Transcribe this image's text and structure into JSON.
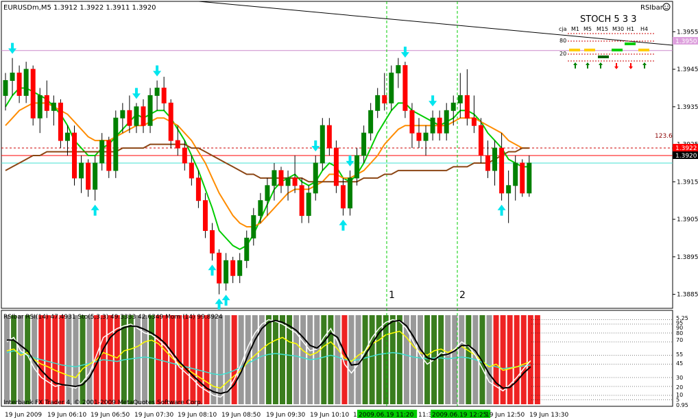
{
  "window": {
    "symbol_line": "EURUSDm,M5  1.3912 1.3922 1.3911 1.3920",
    "indicator_tag": "RSIbar",
    "corner_icon": "smiley-icon"
  },
  "stoch_panel": {
    "title": "STOCH  5 3 3",
    "row_label": "cja",
    "timeframes": [
      "M1",
      "M5",
      "M15",
      "M30",
      "H1",
      "H4"
    ],
    "level_hi": "80",
    "level_lo": "20",
    "directions": [
      "up",
      "up",
      "up",
      "down",
      "down",
      "up"
    ],
    "colors": {
      "up": "#008000",
      "down": "#ff0000",
      "bar_yellow": "#ffcc00",
      "bar_green": "#00cc00",
      "bar_dark": "#006400"
    }
  },
  "markers": {
    "vline_1": "1",
    "vline_2": "2",
    "fib_label": "123.6"
  },
  "price_axis": {
    "ticks": [
      "1.3955",
      "1.3945",
      "1.3935",
      "1.3925",
      "1.3915",
      "1.3905",
      "1.3895",
      "1.3885"
    ],
    "tag_pink": "1.3950",
    "tag_red": "1.3922",
    "tag_black": "1.3920"
  },
  "sub_window": {
    "header": "RSIbar RSI(14) 47.4931  Sto(5,3,3) 49.3333  42.6349  Mom (14) 99.8924",
    "footer": "Interbank FX Trader 4, © 2001-2009 MetaQuotes Software Corp.",
    "axis_ticks": [
      "5.25",
      "95",
      "90",
      "80",
      "70",
      "55",
      "45",
      "30",
      "20",
      "10",
      "5",
      "0.95"
    ]
  },
  "time_axis": {
    "labels": [
      "19 Jun 2009",
      "19 Jun 06:10",
      "19 Jun 06:50",
      "19 Jun 07:30",
      "19 Jun 08:10",
      "19 Jun 08:50",
      "19 Jun 09:30",
      "19 Jun 10:10",
      "19",
      "2009.06.19 11:20",
      "11:30",
      "2009.06.19 12:25",
      "19 Jun 12:50",
      "19 Jun 13:30"
    ]
  },
  "chart_data": {
    "type": "candlestick",
    "symbol": "EURUSDm",
    "timeframe": "M5",
    "ohlc_header": {
      "open": 1.3912,
      "high": 1.3922,
      "low": 1.3911,
      "close": 1.392
    },
    "ylim": [
      1.3882,
      1.3962
    ],
    "candles": [
      [
        1.3938,
        1.3944,
        1.3934,
        1.3942
      ],
      [
        1.3942,
        1.3948,
        1.3938,
        1.3944
      ],
      [
        1.3944,
        1.3946,
        1.3936,
        1.3938
      ],
      [
        1.3938,
        1.3947,
        1.3936,
        1.3945
      ],
      [
        1.3945,
        1.3946,
        1.393,
        1.3932
      ],
      [
        1.3932,
        1.394,
        1.3928,
        1.3938
      ],
      [
        1.3938,
        1.3942,
        1.3932,
        1.3934
      ],
      [
        1.3934,
        1.3938,
        1.393,
        1.3936
      ],
      [
        1.3936,
        1.3937,
        1.3924,
        1.3926
      ],
      [
        1.3926,
        1.393,
        1.3922,
        1.3928
      ],
      [
        1.3928,
        1.393,
        1.3914,
        1.3916
      ],
      [
        1.3916,
        1.3922,
        1.3912,
        1.392
      ],
      [
        1.392,
        1.3921,
        1.3911,
        1.3913
      ],
      [
        1.3913,
        1.3922,
        1.391,
        1.392
      ],
      [
        1.392,
        1.3928,
        1.3918,
        1.3926
      ],
      [
        1.3926,
        1.3927,
        1.3916,
        1.3918
      ],
      [
        1.3918,
        1.3934,
        1.3916,
        1.3932
      ],
      [
        1.3932,
        1.3936,
        1.3928,
        1.3934
      ],
      [
        1.3934,
        1.3938,
        1.3928,
        1.393
      ],
      [
        1.393,
        1.3936,
        1.3928,
        1.3935
      ],
      [
        1.3935,
        1.3937,
        1.3928,
        1.393
      ],
      [
        1.393,
        1.394,
        1.3928,
        1.3938
      ],
      [
        1.3938,
        1.3942,
        1.3934,
        1.394
      ],
      [
        1.394,
        1.3943,
        1.3934,
        1.3936
      ],
      [
        1.3936,
        1.3937,
        1.3924,
        1.3926
      ],
      [
        1.3926,
        1.393,
        1.3922,
        1.3924
      ],
      [
        1.3924,
        1.3926,
        1.3918,
        1.392
      ],
      [
        1.392,
        1.3922,
        1.3914,
        1.3916
      ],
      [
        1.3916,
        1.3918,
        1.3908,
        1.391
      ],
      [
        1.391,
        1.3912,
        1.39,
        1.3902
      ],
      [
        1.3902,
        1.3904,
        1.3894,
        1.3896
      ],
      [
        1.3896,
        1.3897,
        1.3885,
        1.3888
      ],
      [
        1.3888,
        1.3896,
        1.3886,
        1.3894
      ],
      [
        1.3894,
        1.3895,
        1.3888,
        1.389
      ],
      [
        1.389,
        1.3896,
        1.3888,
        1.3894
      ],
      [
        1.3894,
        1.3902,
        1.3892,
        1.39
      ],
      [
        1.39,
        1.3908,
        1.3898,
        1.3906
      ],
      [
        1.3906,
        1.3912,
        1.3904,
        1.391
      ],
      [
        1.391,
        1.3916,
        1.3906,
        1.3914
      ],
      [
        1.3914,
        1.392,
        1.391,
        1.3918
      ],
      [
        1.3918,
        1.3919,
        1.3912,
        1.3914
      ],
      [
        1.3914,
        1.3918,
        1.391,
        1.3916
      ],
      [
        1.3916,
        1.3922,
        1.3912,
        1.3914
      ],
      [
        1.3914,
        1.3916,
        1.3904,
        1.3906
      ],
      [
        1.3906,
        1.3914,
        1.3904,
        1.3912
      ],
      [
        1.3912,
        1.3922,
        1.391,
        1.392
      ],
      [
        1.392,
        1.3932,
        1.3918,
        1.393
      ],
      [
        1.393,
        1.3932,
        1.3922,
        1.3924
      ],
      [
        1.3924,
        1.3926,
        1.3912,
        1.3914
      ],
      [
        1.3914,
        1.3916,
        1.3906,
        1.3908
      ],
      [
        1.3908,
        1.3918,
        1.3906,
        1.3916
      ],
      [
        1.3916,
        1.3924,
        1.3914,
        1.3922
      ],
      [
        1.3922,
        1.393,
        1.392,
        1.3928
      ],
      [
        1.3928,
        1.3936,
        1.3926,
        1.3934
      ],
      [
        1.3934,
        1.394,
        1.3932,
        1.3938
      ],
      [
        1.3938,
        1.3944,
        1.3934,
        1.3936
      ],
      [
        1.3936,
        1.3946,
        1.3934,
        1.3944
      ],
      [
        1.3944,
        1.3948,
        1.394,
        1.3946
      ],
      [
        1.3946,
        1.3947,
        1.3932,
        1.3934
      ],
      [
        1.3934,
        1.3936,
        1.3924,
        1.3928
      ],
      [
        1.3928,
        1.3932,
        1.3924,
        1.3926
      ],
      [
        1.3926,
        1.393,
        1.3922,
        1.3928
      ],
      [
        1.3928,
        1.3934,
        1.3926,
        1.3932
      ],
      [
        1.3932,
        1.3934,
        1.3926,
        1.3928
      ],
      [
        1.3928,
        1.3936,
        1.3926,
        1.3934
      ],
      [
        1.3934,
        1.3938,
        1.393,
        1.3936
      ],
      [
        1.3936,
        1.3944,
        1.3932,
        1.3938
      ],
      [
        1.3938,
        1.3945,
        1.393,
        1.3932
      ],
      [
        1.3932,
        1.3938,
        1.3928,
        1.393
      ],
      [
        1.393,
        1.3932,
        1.392,
        1.3922
      ],
      [
        1.3922,
        1.3926,
        1.3916,
        1.3918
      ],
      [
        1.3918,
        1.3926,
        1.3914,
        1.3924
      ],
      [
        1.3924,
        1.3928,
        1.391,
        1.3912
      ],
      [
        1.3912,
        1.3918,
        1.3904,
        1.3914
      ],
      [
        1.3914,
        1.3922,
        1.391,
        1.392
      ],
      [
        1.392,
        1.3921,
        1.3911,
        1.3912
      ],
      [
        1.3912,
        1.3922,
        1.3911,
        1.392
      ]
    ],
    "moving_averages": [
      {
        "color": "#00cc00",
        "values": [
          1.3935,
          1.3938,
          1.394,
          1.394,
          1.3939,
          1.3938,
          1.3937,
          1.3935,
          1.3933,
          1.393,
          1.3926,
          1.3924,
          1.3922,
          1.3922,
          1.3924,
          1.3925,
          1.3927,
          1.3929,
          1.3931,
          1.3933,
          1.3932,
          1.3933,
          1.3934,
          1.3934,
          1.3932,
          1.3929,
          1.3926,
          1.3922,
          1.3918,
          1.3913,
          1.3908,
          1.3902,
          1.39,
          1.3898,
          1.3897,
          1.3898,
          1.3901,
          1.3905,
          1.3909,
          1.3913,
          1.3915,
          1.3916,
          1.3917,
          1.3915,
          1.3914,
          1.3915,
          1.3918,
          1.392,
          1.3919,
          1.3916,
          1.3915,
          1.3917,
          1.392,
          1.3924,
          1.3928,
          1.3931,
          1.3934,
          1.3936,
          1.3936,
          1.3934,
          1.3933,
          1.3932,
          1.3931,
          1.393,
          1.3931,
          1.3932,
          1.3934,
          1.3934,
          1.3933,
          1.3931,
          1.3928,
          1.3926,
          1.3924,
          1.3921,
          1.392,
          1.3919,
          1.3919
        ]
      },
      {
        "color": "#ff8c00",
        "values": [
          1.393,
          1.3932,
          1.3934,
          1.3935,
          1.3936,
          1.3936,
          1.3936,
          1.3935,
          1.3934,
          1.3933,
          1.3931,
          1.3929,
          1.3927,
          1.3926,
          1.3926,
          1.3926,
          1.3927,
          1.3928,
          1.3929,
          1.393,
          1.393,
          1.3931,
          1.3932,
          1.3932,
          1.3931,
          1.393,
          1.3928,
          1.3926,
          1.3923,
          1.392,
          1.3916,
          1.3912,
          1.3909,
          1.3906,
          1.3904,
          1.3903,
          1.3903,
          1.3904,
          1.3906,
          1.3908,
          1.391,
          1.3912,
          1.3913,
          1.3913,
          1.3913,
          1.3914,
          1.3915,
          1.3917,
          1.3917,
          1.3916,
          1.3916,
          1.3917,
          1.3918,
          1.392,
          1.3922,
          1.3925,
          1.3927,
          1.3929,
          1.393,
          1.393,
          1.393,
          1.393,
          1.393,
          1.393,
          1.393,
          1.3931,
          1.3932,
          1.3932,
          1.3932,
          1.3931,
          1.393,
          1.3929,
          1.3928,
          1.3926,
          1.3925,
          1.3924,
          1.3924
        ]
      },
      {
        "color": "#8b4513",
        "values": [
          1.3918,
          1.3919,
          1.392,
          1.3921,
          1.3922,
          1.3922,
          1.3923,
          1.3923,
          1.3923,
          1.3923,
          1.3923,
          1.3923,
          1.3923,
          1.3923,
          1.3923,
          1.3923,
          1.3923,
          1.3924,
          1.3924,
          1.3924,
          1.3924,
          1.3925,
          1.3925,
          1.3925,
          1.3925,
          1.3925,
          1.3925,
          1.3924,
          1.3924,
          1.3923,
          1.3922,
          1.3921,
          1.392,
          1.3919,
          1.3918,
          1.3917,
          1.3917,
          1.3916,
          1.3916,
          1.3916,
          1.3916,
          1.3916,
          1.3916,
          1.3916,
          1.3915,
          1.3915,
          1.3915,
          1.3915,
          1.3915,
          1.3915,
          1.3915,
          1.3915,
          1.3916,
          1.3916,
          1.3916,
          1.3917,
          1.3917,
          1.3918,
          1.3918,
          1.3918,
          1.3918,
          1.3918,
          1.3918,
          1.3918,
          1.3918,
          1.3919,
          1.3919,
          1.3919,
          1.392,
          1.392,
          1.392,
          1.3921,
          1.3922,
          1.3923,
          1.3923,
          1.3924,
          1.3924
        ]
      }
    ],
    "horizontal_lines": [
      {
        "value": 1.395,
        "color": "#cc88cc"
      },
      {
        "value": 1.3922,
        "color": "#ff0000"
      },
      {
        "value": 1.392,
        "color": "#40e0d0"
      },
      {
        "value": 1.3924,
        "color": "#cc0000",
        "style": "dashed",
        "label": "123.6"
      }
    ],
    "arrows": [
      {
        "idx": 1,
        "dir": "down"
      },
      {
        "idx": 13,
        "dir": "up"
      },
      {
        "idx": 19,
        "dir": "down"
      },
      {
        "idx": 22,
        "dir": "down"
      },
      {
        "idx": 30,
        "dir": "up"
      },
      {
        "idx": 31,
        "dir": "up"
      },
      {
        "idx": 32,
        "dir": "up"
      },
      {
        "idx": 45,
        "dir": "down"
      },
      {
        "idx": 49,
        "dir": "up"
      },
      {
        "idx": 50,
        "dir": "down"
      },
      {
        "idx": 58,
        "dir": "down"
      },
      {
        "idx": 62,
        "dir": "down"
      },
      {
        "idx": 72,
        "dir": "up"
      }
    ],
    "sub_indicator": {
      "levels": [
        95,
        90,
        80,
        70,
        55,
        45,
        30,
        20,
        10,
        5
      ],
      "bar_states": [
        "grey",
        "green",
        "grey",
        "green",
        "grey",
        "red",
        "red",
        "red",
        "red",
        "grey",
        "grey",
        "green",
        "grey",
        "red",
        "red",
        "red",
        "red",
        "green",
        "green",
        "grey",
        "grey",
        "green",
        "red",
        "red",
        "red",
        "red",
        "red",
        "red",
        "red",
        "red",
        "grey",
        "grey",
        "grey",
        "red",
        "grey",
        "grey",
        "grey",
        "grey",
        "green",
        "green",
        "green",
        "green",
        "grey",
        "grey",
        "grey",
        "grey",
        "green",
        "green",
        "grey",
        "red",
        "grey",
        "grey",
        "green",
        "green",
        "green",
        "green",
        "green",
        "green",
        "grey",
        "grey",
        "grey",
        "green",
        "green",
        "green",
        "grey",
        "grey",
        "grey",
        "green",
        "grey",
        "green",
        "grey",
        "red",
        "red",
        "red",
        "red",
        "red",
        "red",
        "red"
      ],
      "rsi": [
        60,
        62,
        55,
        58,
        50,
        45,
        42,
        38,
        35,
        32,
        30,
        40,
        45,
        50,
        58,
        55,
        52,
        60,
        62,
        65,
        70,
        72,
        68,
        60,
        52,
        45,
        40,
        35,
        30,
        25,
        20,
        18,
        25,
        32,
        38,
        48,
        55,
        62,
        68,
        72,
        75,
        70,
        68,
        60,
        55,
        58,
        65,
        70,
        62,
        52,
        48,
        55,
        60,
        68,
        72,
        78,
        80,
        82,
        75,
        65,
        58,
        55,
        60,
        62,
        58,
        62,
        65,
        60,
        55,
        48,
        42,
        45,
        38,
        40,
        42,
        45,
        48
      ],
      "stoch_main": [
        70,
        75,
        60,
        55,
        40,
        30,
        25,
        20,
        22,
        20,
        18,
        25,
        35,
        55,
        75,
        80,
        85,
        88,
        90,
        85,
        80,
        78,
        72,
        65,
        55,
        42,
        35,
        28,
        20,
        15,
        10,
        8,
        15,
        28,
        45,
        65,
        80,
        90,
        95,
        93,
        90,
        85,
        80,
        70,
        60,
        62,
        75,
        85,
        70,
        45,
        35,
        45,
        60,
        75,
        85,
        92,
        95,
        93,
        85,
        70,
        55,
        45,
        50,
        58,
        55,
        62,
        70,
        65,
        55,
        40,
        25,
        20,
        15,
        22,
        30,
        40,
        49
      ],
      "stoch_signal": [
        72,
        72,
        66,
        60,
        48,
        38,
        30,
        24,
        22,
        21,
        20,
        22,
        30,
        45,
        62,
        75,
        82,
        86,
        88,
        87,
        84,
        80,
        75,
        68,
        58,
        48,
        40,
        32,
        25,
        18,
        14,
        12,
        14,
        22,
        36,
        55,
        72,
        85,
        92,
        94,
        92,
        88,
        83,
        75,
        66,
        63,
        70,
        80,
        75,
        58,
        44,
        45,
        55,
        68,
        80,
        88,
        93,
        94,
        88,
        76,
        62,
        52,
        50,
        55,
        56,
        60,
        66,
        66,
        60,
        48,
        34,
        24,
        18,
        19,
        26,
        35,
        42
      ],
      "mom": [
        58,
        60,
        58,
        55,
        52,
        50,
        48,
        46,
        44,
        43,
        42,
        44,
        46,
        48,
        50,
        49,
        48,
        50,
        51,
        52,
        53,
        52,
        50,
        48,
        46,
        44,
        42,
        40,
        38,
        36,
        34,
        33,
        35,
        38,
        42,
        46,
        50,
        54,
        56,
        57,
        56,
        55,
        54,
        52,
        50,
        51,
        53,
        55,
        53,
        50,
        49,
        50,
        52,
        54,
        56,
        57,
        58,
        57,
        55,
        53,
        52,
        51,
        52,
        52,
        51,
        52,
        53,
        52,
        50,
        47,
        44,
        42,
        40,
        41,
        42,
        43,
        44
      ]
    }
  }
}
